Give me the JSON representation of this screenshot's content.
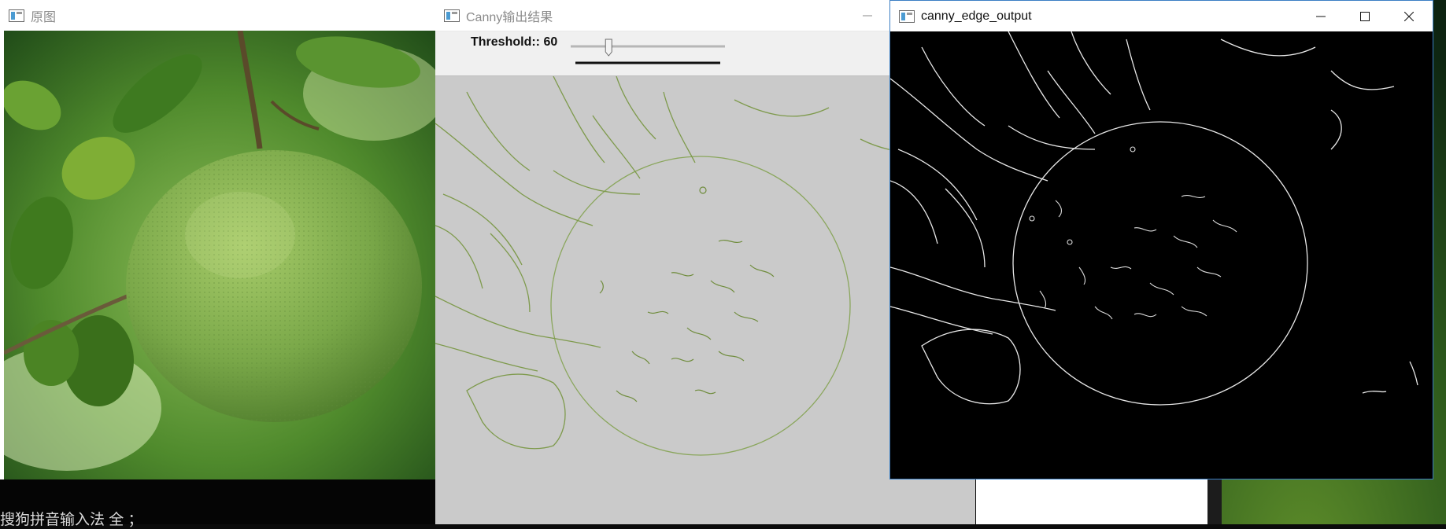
{
  "windows": {
    "original": {
      "title": "原图"
    },
    "canny": {
      "title": "Canny输出结果",
      "threshold_label": "Threshold:: 60",
      "threshold": {
        "value": 60,
        "min": 0,
        "max": 255
      }
    },
    "edge_output": {
      "title": "canny_edge_output"
    }
  },
  "taskbar": {
    "ime_status": "搜狗拼音输入法 全 ；"
  },
  "icons": {
    "app": "window-app-icon",
    "minimize": "minimize-icon",
    "maximize": "maximize-icon",
    "close": "close-icon"
  },
  "colors": {
    "active_border": "#3b7fc4",
    "edge_canvas": "#000000",
    "canny_canvas": "#cacaca",
    "fruit": "#7aa849"
  }
}
